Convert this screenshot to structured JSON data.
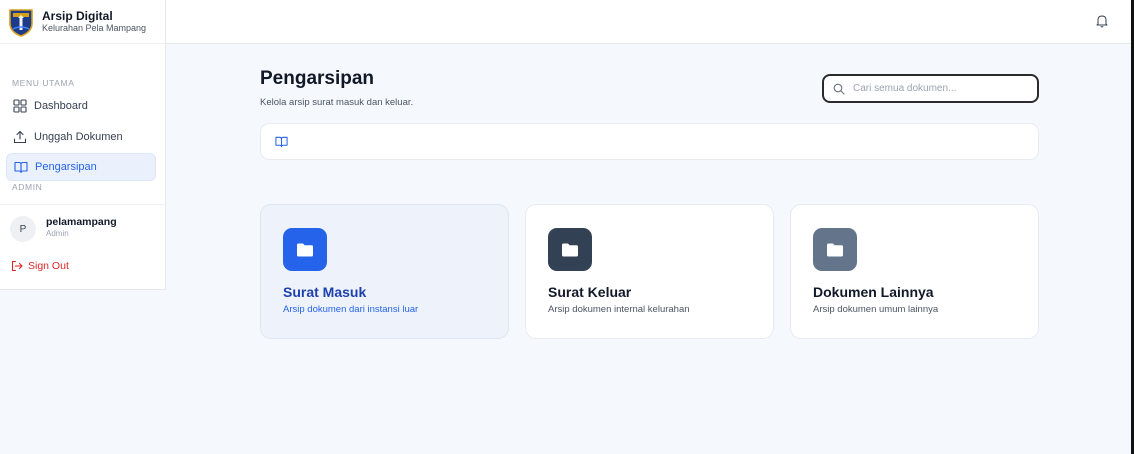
{
  "brand": {
    "title": "Arsip Digital",
    "subtitle": "Kelurahan Pela Mampang"
  },
  "sidebar": {
    "menu_heading": "MENU UTAMA",
    "items": [
      {
        "label": "Dashboard",
        "icon": "dashboard-grid-icon",
        "active": false
      },
      {
        "label": "Unggah Dokumen",
        "icon": "upload-icon",
        "active": false
      },
      {
        "label": "Pengarsipan",
        "icon": "book-open-icon",
        "active": true
      }
    ],
    "admin_heading": "ADMIN",
    "user": {
      "initial": "P",
      "name": "pelamampang",
      "role": "Admin"
    },
    "signout_label": "Sign Out"
  },
  "topbar": {
    "icon": "bell-icon"
  },
  "main": {
    "title": "Pengarsipan",
    "subtitle": "Kelola arsip surat masuk dan keluar.",
    "search": {
      "placeholder": "Cari semua dokumen...",
      "value": ""
    },
    "breadcrumb_icon": "book-open-icon",
    "cards": [
      {
        "title": "Surat Masuk",
        "description": "Arsip dokumen dari instansi luar",
        "icon": "folder-icon",
        "color": "#2563eb",
        "active": true
      },
      {
        "title": "Surat Keluar",
        "description": "Arsip dokumen internal kelurahan",
        "icon": "folder-icon",
        "color": "#334155",
        "active": false
      },
      {
        "title": "Dokumen Lainnya",
        "description": "Arsip dokumen umum lainnya",
        "icon": "folder-icon",
        "color": "#64748b",
        "active": false
      }
    ]
  },
  "colors": {
    "accent": "#2563eb",
    "danger": "#dc2626",
    "background": "#f5f8fc"
  }
}
